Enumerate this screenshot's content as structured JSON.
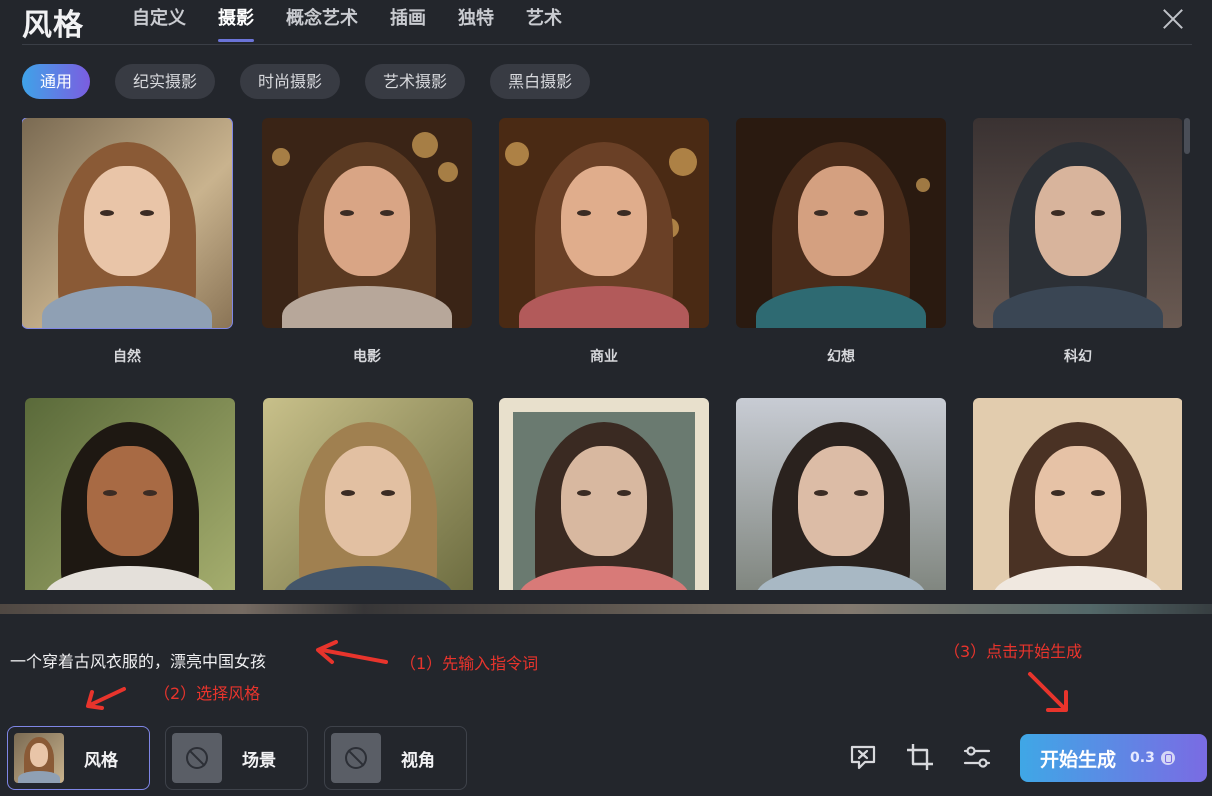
{
  "header": {
    "title": "风格",
    "tabs": [
      {
        "label": "自定义",
        "active": false
      },
      {
        "label": "摄影",
        "active": true
      },
      {
        "label": "概念艺术",
        "active": false
      },
      {
        "label": "插画",
        "active": false
      },
      {
        "label": "独特",
        "active": false
      },
      {
        "label": "艺术",
        "active": false
      }
    ]
  },
  "sub_tabs": [
    {
      "label": "通用",
      "active": true
    },
    {
      "label": "纪实摄影",
      "active": false
    },
    {
      "label": "时尚摄影",
      "active": false
    },
    {
      "label": "艺术摄影",
      "active": false
    },
    {
      "label": "黑白摄影",
      "active": false
    }
  ],
  "styles": [
    {
      "label": "自然",
      "selected": true
    },
    {
      "label": "电影",
      "selected": false
    },
    {
      "label": "商业",
      "selected": false
    },
    {
      "label": "幻想",
      "selected": false
    },
    {
      "label": "科幻",
      "selected": false
    },
    {
      "label": "",
      "selected": false
    },
    {
      "label": "",
      "selected": false
    },
    {
      "label": "",
      "selected": false
    },
    {
      "label": "",
      "selected": false
    },
    {
      "label": "",
      "selected": false
    }
  ],
  "prompt": {
    "text": "一个穿着古风衣服的，漂亮中国女孩"
  },
  "annotations": {
    "step1": "（1）先输入指令词",
    "step2": "（2）选择风格",
    "step3": "（3）点击开始生成"
  },
  "bottom_bar": {
    "style_button": "风格",
    "scene_button": "场景",
    "angle_button": "视角",
    "generate_label": "开始生成",
    "generate_cost": "0.3"
  },
  "colors": {
    "background": "#23262c",
    "accent_start": "#3fa7e6",
    "accent_end": "#7a6be3",
    "annotation_red": "#e8342c"
  }
}
